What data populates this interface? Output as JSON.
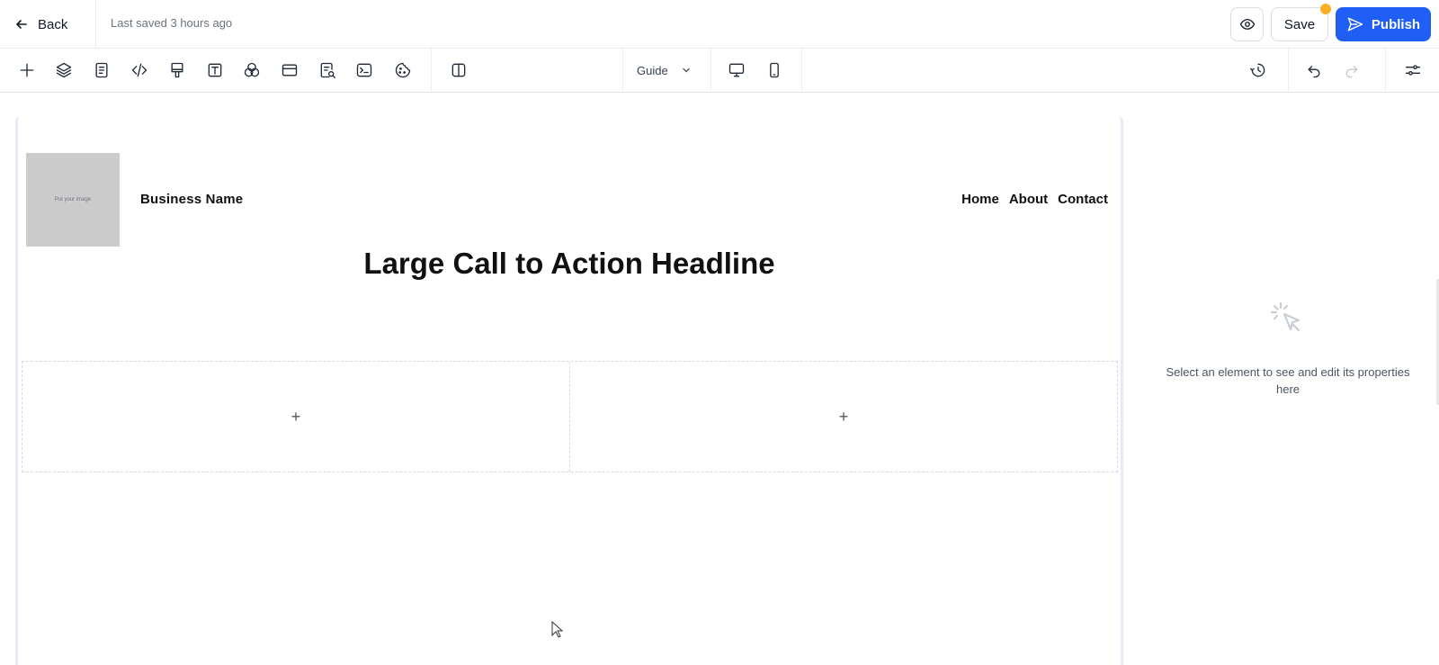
{
  "topbar": {
    "back_label": "Back",
    "last_saved": "Last saved 3 hours ago",
    "save_label": "Save",
    "publish_label": "Publish",
    "unsaved_dot_color": "#fbb024",
    "publish_color": "#1f5ff5"
  },
  "toolbar": {
    "tools": [
      "add-icon",
      "layers-icon",
      "pages-icon",
      "code-icon",
      "paint-roller-icon",
      "text-icon",
      "color-circles-icon",
      "section-icon",
      "seo-icon",
      "terminal-icon",
      "cookie-icon",
      "split-view-icon"
    ],
    "guide_label": "Guide",
    "device_options": [
      "desktop-icon",
      "mobile-icon"
    ],
    "right_tools": [
      "history-icon",
      "undo-icon",
      "redo-icon",
      "settings-sliders-icon"
    ]
  },
  "canvas": {
    "logo_placeholder": "Put your image",
    "business_name": "Business Name",
    "nav": [
      "Home",
      "About",
      "Contact"
    ],
    "headline": "Large Call to Action Headline",
    "drop_columns": [
      "+",
      "+"
    ]
  },
  "properties_panel": {
    "empty_message": "Select an element to see and edit its properties here"
  }
}
